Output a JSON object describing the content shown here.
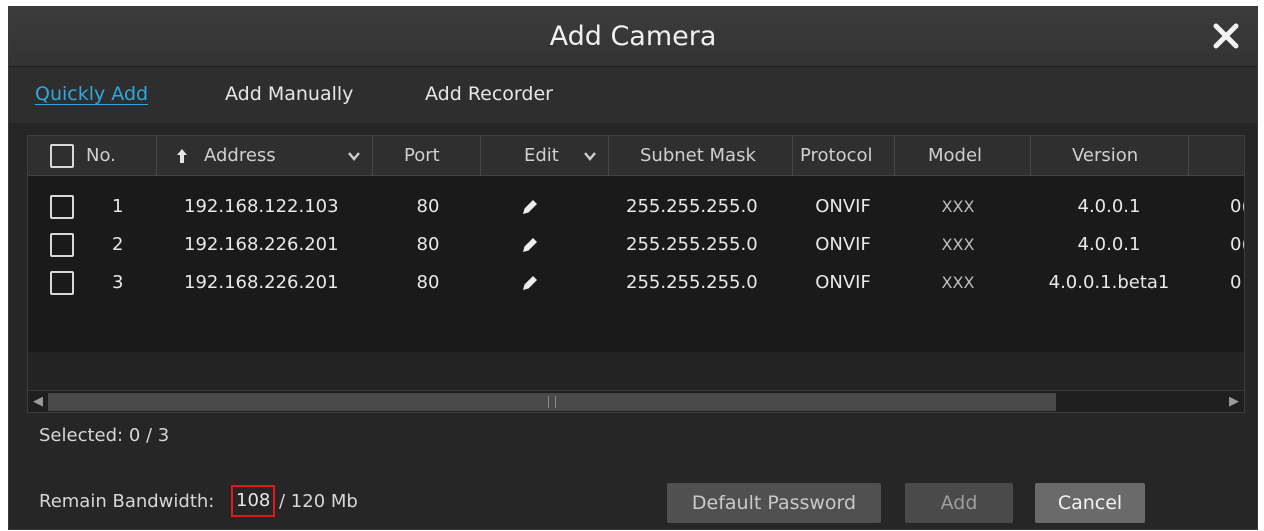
{
  "dialog": {
    "title": "Add Camera",
    "close_icon": "close-icon"
  },
  "tabs": [
    {
      "label": "Quickly Add",
      "active": true
    },
    {
      "label": "Add Manually",
      "active": false
    },
    {
      "label": "Add Recorder",
      "active": false
    }
  ],
  "table": {
    "columns": {
      "no": "No.",
      "address": "Address",
      "port": "Port",
      "edit": "Edit",
      "subnet_mask": "Subnet Mask",
      "protocol": "Protocol",
      "model": "Model",
      "version": "Version"
    },
    "rows": [
      {
        "no": "1",
        "address": "192.168.122.103",
        "port": "80",
        "subnet_mask": "255.255.255.0",
        "protocol": "ONVIF",
        "model": "XXX",
        "version": "4.0.0.1",
        "overflow": "0("
      },
      {
        "no": "2",
        "address": "192.168.226.201",
        "port": "80",
        "subnet_mask": "255.255.255.0",
        "protocol": "ONVIF",
        "model": "XXX",
        "version": "4.0.0.1",
        "overflow": "0("
      },
      {
        "no": "3",
        "address": "192.168.226.201",
        "port": "80",
        "subnet_mask": "255.255.255.0",
        "protocol": "ONVIF",
        "model": "XXX",
        "version": "4.0.0.1.beta1",
        "overflow": "0"
      }
    ],
    "icons": {
      "sort": "sort-up-arrow-icon",
      "dropdown": "chevron-down-icon",
      "edit": "pencil-icon",
      "scroll_left": "scroll-left-icon",
      "scroll_right": "scroll-right-icon"
    }
  },
  "footer": {
    "selected_text": "Selected: 0 / 3",
    "bandwidth_label": "Remain Bandwidth:",
    "bandwidth_value": "108",
    "bandwidth_total": "/ 120 Mb",
    "buttons": {
      "default_password": "Default Password",
      "add": "Add",
      "cancel": "Cancel"
    }
  },
  "colors": {
    "accent": "#2ea8de",
    "highlight_box": "#e0191f",
    "background": "#262626"
  }
}
